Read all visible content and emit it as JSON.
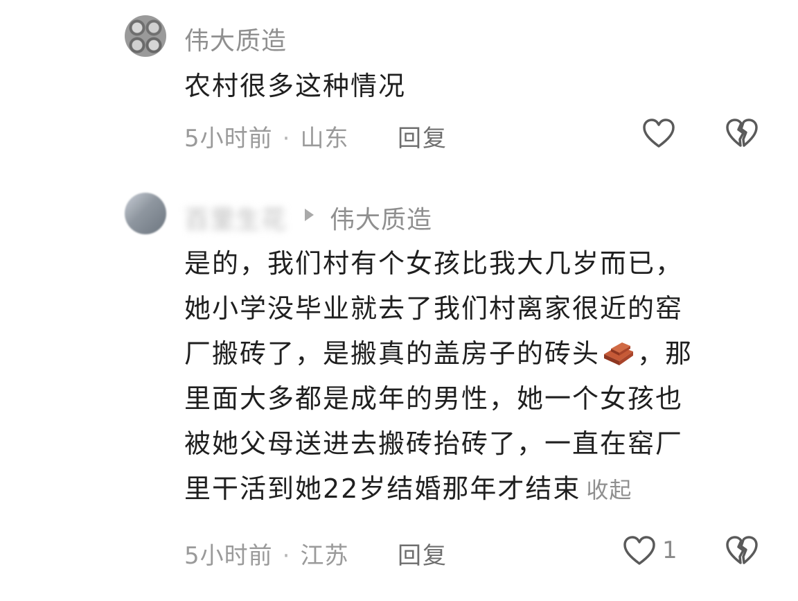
{
  "comments": [
    {
      "username": "伟大质造",
      "text": "农村很多这种情况",
      "time": "5小时前",
      "location": "山东",
      "reply_label": "回复",
      "like_count": ""
    },
    {
      "username": "百里生花",
      "reply_to": "伟大质造",
      "text_lines": [
        "是的，我们村有个女孩比我大几岁而已，",
        "她小学没毕业就去了我们村离家很近的窑",
        "厂搬砖了，是搬真的盖房子的砖头",
        "，那",
        "里面大多都是成年的男性，她一个女孩也",
        "被她父母送进去搬砖抬砖了，一直在窑厂",
        "里干活到她22岁结婚那年才结束"
      ],
      "collapse_label": "收起",
      "time": "5小时前",
      "location": "江苏",
      "reply_label": "回复",
      "like_count": "1"
    }
  ],
  "icons": {
    "like": "heart-outline-icon",
    "dislike": "broken-heart-icon",
    "brick": "brick-emoji"
  },
  "colors": {
    "text": "#1f1f1f",
    "meta": "#9a9a9a",
    "icon": "#5a5a5a",
    "brick": "#b5482a"
  }
}
